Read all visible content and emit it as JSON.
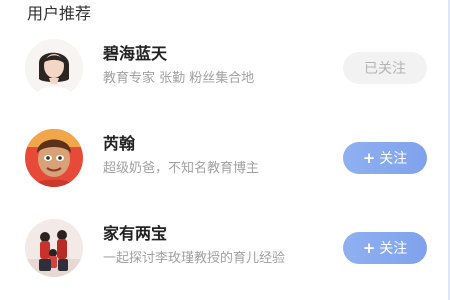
{
  "section": {
    "title": "用户推荐"
  },
  "users": [
    {
      "name": "碧海蓝天",
      "description": "教育专家 张勤 粉丝集合地",
      "button_label": "已关注",
      "followed": true,
      "avatar": "woman-portrait-avatar"
    },
    {
      "name": "芮翰",
      "description": "超级奶爸，不知名教育博主",
      "button_label": "关注",
      "followed": false,
      "avatar": "cartoon-boy-avatar"
    },
    {
      "name": "家有两宝",
      "description": "一起探讨李玫瑾教授的育儿经验",
      "button_label": "关注",
      "followed": false,
      "avatar": "family-photo-avatar"
    }
  ],
  "colors": {
    "follow_button": "#86a8ee",
    "followed_button": "#f2f2f2",
    "followed_text": "#b4b4b4",
    "description_text": "#a0a0a0"
  },
  "icons": {
    "follow_plus": "plus-icon"
  }
}
